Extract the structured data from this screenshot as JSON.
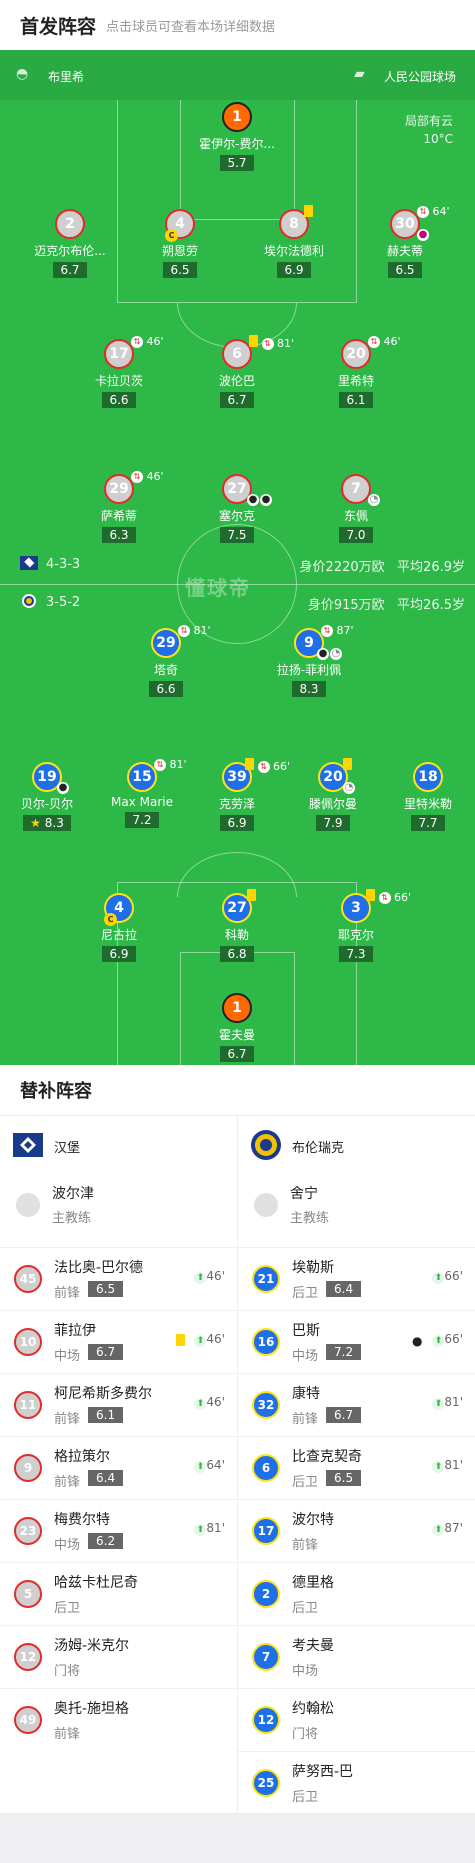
{
  "header": {
    "title": "首发阵容",
    "subtitle": "点击球员可查看本场详细数据"
  },
  "teams": {
    "home": "布里希",
    "venue": "人民公园球场"
  },
  "weather": {
    "condition": "局部有云",
    "temp": "10°C"
  },
  "watermark": "懂球帝",
  "home": {
    "formation": "4-3-3",
    "value": "身价2220万欧",
    "age": "平均26.9岁"
  },
  "away": {
    "formation": "3-5-2",
    "value": "身价915万欧",
    "age": "平均26.5岁"
  },
  "pitch_players": [
    {
      "num": "1",
      "name": "霍伊尔-费尔...",
      "rating": "5.7"
    },
    {
      "num": "2",
      "name": "迈克尔布伦...",
      "rating": "6.7"
    },
    {
      "num": "4",
      "name": "朔恩劳",
      "rating": "6.5",
      "captain": "C"
    },
    {
      "num": "8",
      "name": "埃尔法德利",
      "rating": "6.9"
    },
    {
      "num": "30",
      "name": "赫夫蒂",
      "rating": "6.5",
      "min": "64'"
    },
    {
      "num": "17",
      "name": "卡拉贝茨",
      "rating": "6.6",
      "min": "46'"
    },
    {
      "num": "6",
      "name": "波伦巴",
      "rating": "6.7",
      "min": "81'"
    },
    {
      "num": "20",
      "name": "里希特",
      "rating": "6.1",
      "min": "46'"
    },
    {
      "num": "29",
      "name": "萨希蒂",
      "rating": "6.3",
      "min": "46'"
    },
    {
      "num": "27",
      "name": "塞尔克",
      "rating": "7.5"
    },
    {
      "num": "7",
      "name": "东佩",
      "rating": "7.0"
    },
    {
      "num": "29",
      "name": "塔奇",
      "rating": "6.6",
      "min": "81'"
    },
    {
      "num": "9",
      "name": "拉扬-菲利佩",
      "rating": "8.3",
      "min": "87'"
    },
    {
      "num": "19",
      "name": "贝尔-贝尔",
      "rating": "8.3"
    },
    {
      "num": "15",
      "name": "Max Marie",
      "rating": "7.2",
      "min": "81'"
    },
    {
      "num": "39",
      "name": "克劳泽",
      "rating": "6.9",
      "min": "66'"
    },
    {
      "num": "20",
      "name": "滕佩尔曼",
      "rating": "7.9"
    },
    {
      "num": "18",
      "name": "里特米勒",
      "rating": "7.7"
    },
    {
      "num": "4",
      "name": "尼古拉",
      "rating": "6.9",
      "captain": "C"
    },
    {
      "num": "27",
      "name": "科勒",
      "rating": "6.8"
    },
    {
      "num": "3",
      "name": "耶克尔",
      "rating": "7.3",
      "min": "66'"
    },
    {
      "num": "1",
      "name": "霍夫曼",
      "rating": "6.7"
    }
  ],
  "subs": {
    "title": "替补阵容",
    "left": {
      "team": "汉堡",
      "coach": "波尔津",
      "coach_role": "主教练",
      "players": [
        {
          "num": "45",
          "name": "法比奥-巴尔德",
          "pos": "前锋",
          "rating": "6.5",
          "min": "46'"
        },
        {
          "num": "10",
          "name": "菲拉伊",
          "pos": "中场",
          "rating": "6.7",
          "min": "46'"
        },
        {
          "num": "11",
          "name": "柯尼希斯多费尔",
          "pos": "前锋",
          "rating": "6.1",
          "min": "46'"
        },
        {
          "num": "9",
          "name": "格拉策尔",
          "pos": "前锋",
          "rating": "6.4",
          "min": "64'"
        },
        {
          "num": "23",
          "name": "梅费尔特",
          "pos": "中场",
          "rating": "6.2",
          "min": "81'"
        },
        {
          "num": "5",
          "name": "哈兹卡杜尼奇",
          "pos": "后卫"
        },
        {
          "num": "12",
          "name": "汤姆-米克尔",
          "pos": "门将"
        },
        {
          "num": "49",
          "name": "奥托-施坦格",
          "pos": "前锋"
        }
      ]
    },
    "right": {
      "team": "布伦瑞克",
      "coach": "舍宁",
      "coach_role": "主教练",
      "players": [
        {
          "num": "21",
          "name": "埃勒斯",
          "pos": "后卫",
          "rating": "6.4",
          "min": "66'"
        },
        {
          "num": "16",
          "name": "巴斯",
          "pos": "中场",
          "rating": "7.2",
          "min": "66'"
        },
        {
          "num": "32",
          "name": "康特",
          "pos": "前锋",
          "rating": "6.7",
          "min": "81'"
        },
        {
          "num": "6",
          "name": "比查克契奇",
          "pos": "后卫",
          "rating": "6.5",
          "min": "81'"
        },
        {
          "num": "17",
          "name": "波尔特",
          "pos": "前锋",
          "min": "87'"
        },
        {
          "num": "2",
          "name": "德里格",
          "pos": "后卫"
        },
        {
          "num": "7",
          "name": "考夫曼",
          "pos": "中场"
        },
        {
          "num": "12",
          "name": "约翰松",
          "pos": "门将"
        },
        {
          "num": "25",
          "name": "萨努西-巴",
          "pos": "后卫"
        }
      ]
    }
  }
}
